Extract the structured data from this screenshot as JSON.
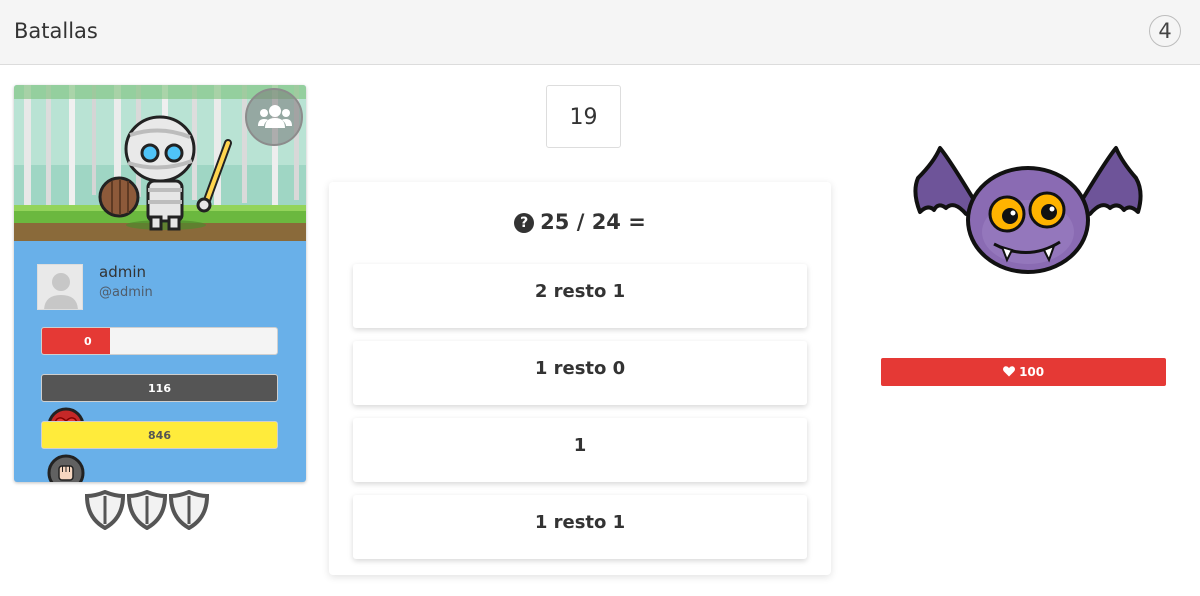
{
  "header": {
    "title": "Batallas",
    "count": "4"
  },
  "player": {
    "name": "admin",
    "handle": "@admin",
    "stats": {
      "health": {
        "value": "0",
        "fill_fraction": 0.29
      },
      "strength": {
        "value": "116",
        "fill_fraction": 1.0
      },
      "gold": {
        "value": "846",
        "fill_fraction": 1.0
      }
    },
    "shields_count": 3
  },
  "timer": "19",
  "question": {
    "text": "25 / 24 ="
  },
  "answers": [
    "2 resto 1",
    "1 resto 0",
    "1",
    "1 resto 1"
  ],
  "enemy": {
    "hp": "100"
  },
  "colors": {
    "player_card": "#69b0e9",
    "health": "#e53935",
    "strength": "#555555",
    "gold": "#ffeb3b",
    "enemy_hp": "#e53935",
    "enemy_body": "#8a6bb3"
  },
  "icons": [
    "group-icon",
    "heart-icon",
    "fist-icon",
    "coins-icon",
    "shield-icon",
    "question-icon",
    "bat-monster"
  ]
}
